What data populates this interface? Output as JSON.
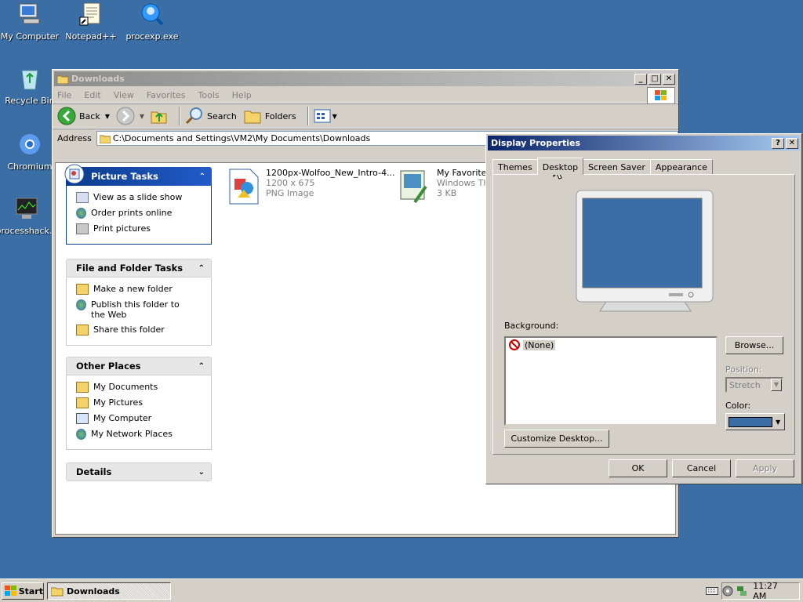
{
  "desktop": {
    "icons": [
      {
        "label": "My Computer"
      },
      {
        "label": "Notepad++"
      },
      {
        "label": "procexp.exe"
      },
      {
        "label": "Recycle Bin"
      },
      {
        "label": "Chromium"
      },
      {
        "label": "processhack..."
      }
    ]
  },
  "explorer": {
    "title": "Downloads",
    "menu": [
      "File",
      "Edit",
      "View",
      "Favorites",
      "Tools",
      "Help"
    ],
    "toolbar": {
      "back": "Back",
      "search": "Search",
      "folders": "Folders"
    },
    "address_label": "Address",
    "address": "C:\\Documents and Settings\\VM2\\My Documents\\Downloads",
    "panels": {
      "picture_tasks": {
        "title": "Picture Tasks",
        "items": [
          "View as a slide show",
          "Order prints online",
          "Print pictures"
        ]
      },
      "file_tasks": {
        "title": "File and Folder Tasks",
        "items": [
          "Make a new folder",
          "Publish this folder to the Web",
          "Share this folder"
        ]
      },
      "other_places": {
        "title": "Other Places",
        "items": [
          "My Documents",
          "My Pictures",
          "My Computer",
          "My Network Places"
        ]
      },
      "details": {
        "title": "Details"
      }
    },
    "files": [
      {
        "name": "1200px-Wolfoo_New_Intro-4...",
        "meta1": "1200 x 675",
        "meta2": "PNG Image"
      },
      {
        "name": "My Favorite T",
        "meta1": "Windows The",
        "meta2": "3 KB"
      }
    ]
  },
  "dialog": {
    "title": "Display Properties",
    "tabs": [
      "Themes",
      "Desktop",
      "Screen Saver",
      "Appearance"
    ],
    "selected_tab": "Desktop",
    "background_label": "Background:",
    "background_items": [
      "(None)"
    ],
    "browse": "Browse...",
    "position_label": "Position:",
    "position_value": "Stretch",
    "color_label": "Color:",
    "color_value": "#3a6ea5",
    "customize": "Customize Desktop...",
    "ok": "OK",
    "cancel": "Cancel",
    "apply": "Apply"
  },
  "taskbar": {
    "start": "Start",
    "task": "Downloads",
    "clock": "11:27 AM"
  },
  "colors": {
    "desktop": "#3a6ea5",
    "active_title": "#0a246a",
    "link": "#215dc6"
  }
}
